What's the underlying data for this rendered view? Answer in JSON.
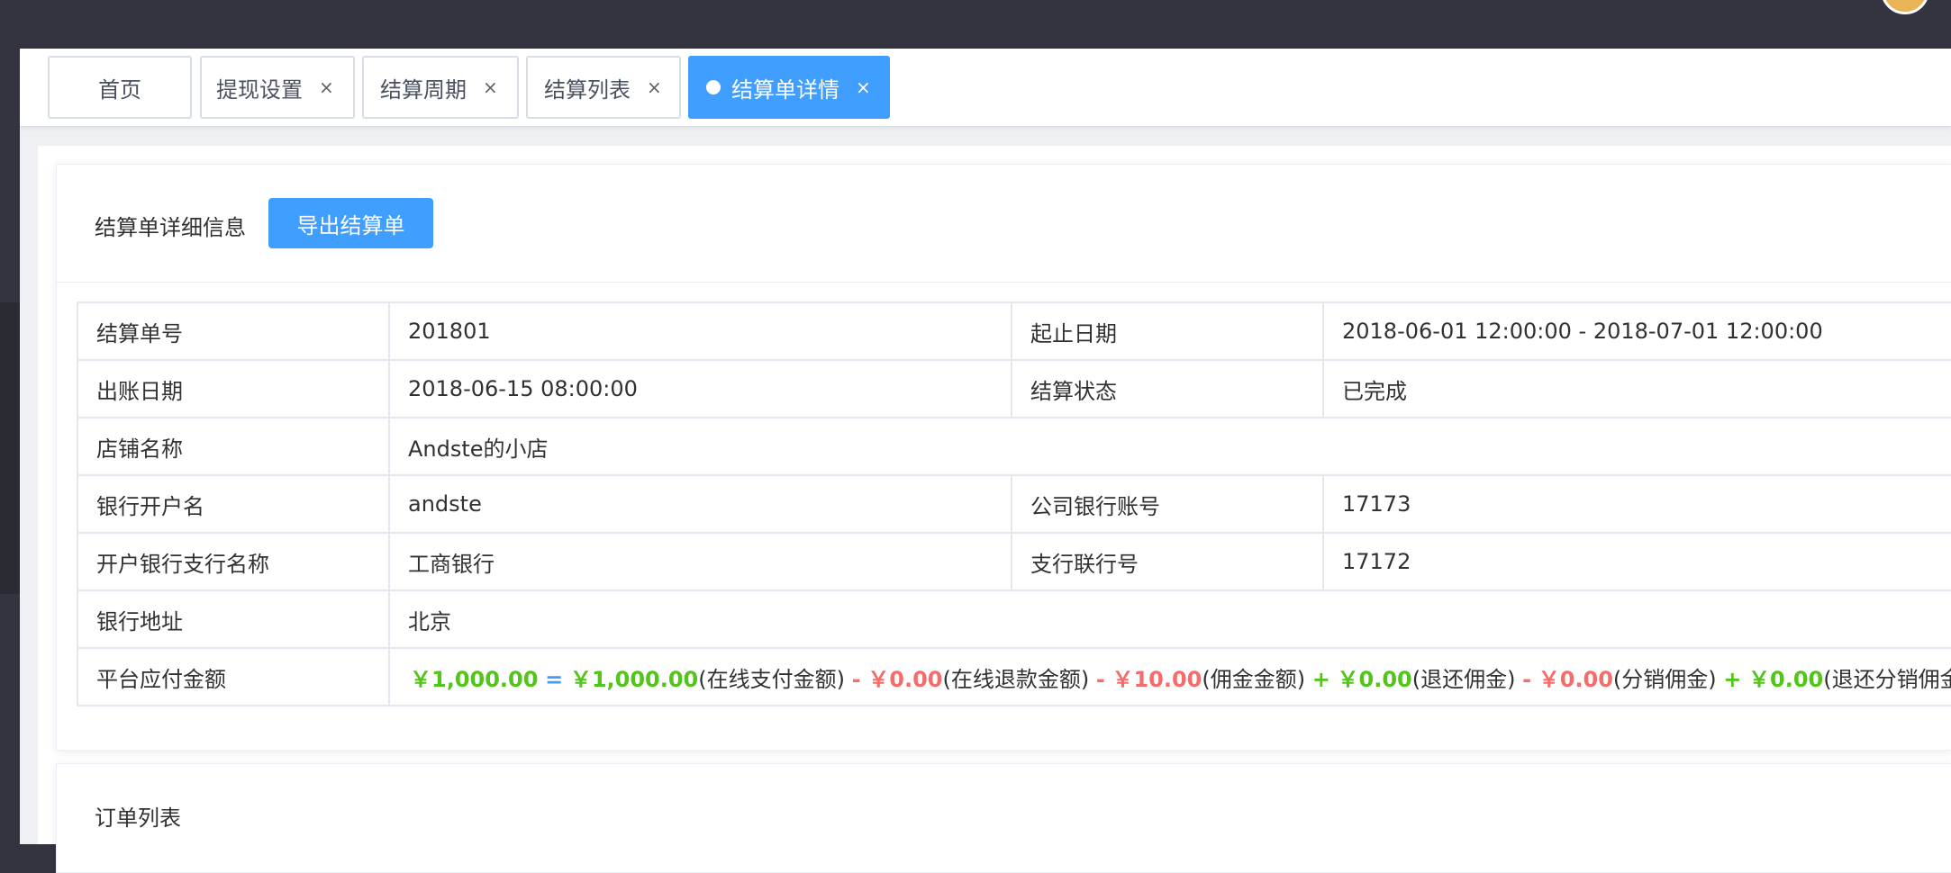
{
  "tabs": [
    {
      "label": "首页",
      "closable": false,
      "active": false
    },
    {
      "label": "提现设置",
      "closable": true,
      "active": false
    },
    {
      "label": "结算周期",
      "closable": true,
      "active": false
    },
    {
      "label": "结算列表",
      "closable": true,
      "active": false
    },
    {
      "label": "结算单详情",
      "closable": true,
      "active": true
    }
  ],
  "close_glyph": "×",
  "detail": {
    "title": "结算单详细信息",
    "export_button": "导出结算单"
  },
  "info": {
    "order_no_label": "结算单号",
    "order_no": "201801",
    "period_label": "起止日期",
    "period": "2018-06-01 12:00:00 - 2018-07-01 12:00:00",
    "bill_date_label": "出账日期",
    "bill_date": "2018-06-15 08:00:00",
    "status_label": "结算状态",
    "status": "已完成",
    "shop_label": "店铺名称",
    "shop": "Andste的小店",
    "account_name_label": "银行开户名",
    "account_name": "andste",
    "bank_account_label": "公司银行账号",
    "bank_account": "17173",
    "branch_name_label": "开户银行支行名称",
    "branch_name": "工商银行",
    "branch_code_label": "支行联行号",
    "branch_code": "17172",
    "bank_address_label": "银行地址",
    "bank_address": "北京",
    "payable_label": "平台应付金额"
  },
  "formula": {
    "total": "￥1,000.00",
    "eq": "=",
    "online_pay": "￥1,000.00",
    "online_pay_label": "(在线支付金额)",
    "op1": "-",
    "online_refund": "￥0.00",
    "online_refund_label": "(在线退款金额)",
    "op2": "-",
    "commission": "￥10.00",
    "commission_label": "(佣金金额)",
    "op3": "+",
    "refund_commission": "￥0.00",
    "refund_commission_label": "(退还佣金)",
    "op4": "-",
    "dist_commission": "￥0.00",
    "dist_commission_label": "(分销佣金)",
    "op5": "+",
    "refund_dist_commission": "￥0.00",
    "refund_dist_commission_label": "(退还分销佣金)"
  },
  "orders": {
    "title": "订单列表"
  },
  "colors": {
    "accent": "#409eff",
    "positive": "#52c41a",
    "negative": "#f56c6c",
    "chrome": "#33343f"
  }
}
